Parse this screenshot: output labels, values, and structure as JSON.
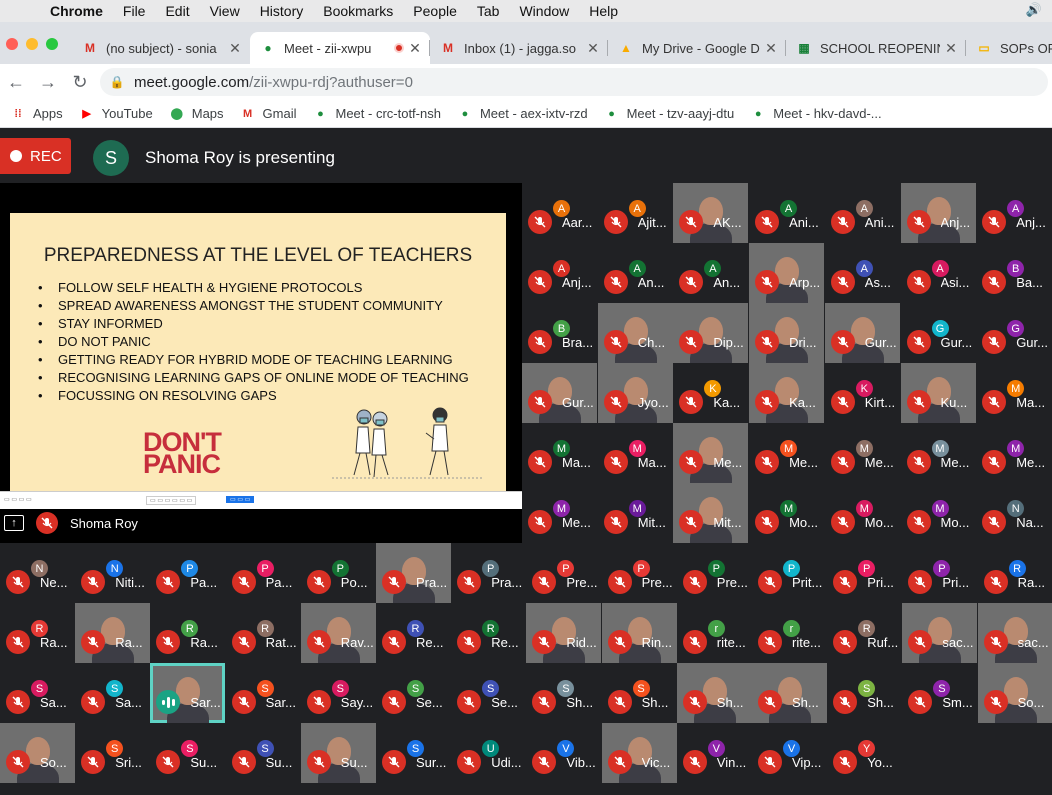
{
  "menubar": {
    "app": "Chrome",
    "items": [
      "File",
      "Edit",
      "View",
      "History",
      "Bookmarks",
      "People",
      "Tab",
      "Window",
      "Help"
    ]
  },
  "tabs": [
    {
      "title": "(no subject) - sonia",
      "icon": "gmail-icon",
      "color": "#d93025"
    },
    {
      "title": "Meet - zii-xwpu",
      "icon": "meet-icon",
      "color": "#1e8e3e",
      "active": true
    },
    {
      "title": "Inbox (1) - jagga.so",
      "icon": "gmail-icon",
      "color": "#d93025"
    },
    {
      "title": "My Drive - Google D",
      "icon": "drive-icon",
      "color": "#f9ab00"
    },
    {
      "title": "SCHOOL REOPENIN",
      "icon": "sheets-icon",
      "color": "#188038"
    },
    {
      "title": "SOPs OF",
      "icon": "slides-icon",
      "color": "#f4b400"
    }
  ],
  "url": {
    "host": "meet.google.com",
    "path": "/zii-xwpu-rdj?authuser=0"
  },
  "bookmarks": [
    {
      "label": "Apps",
      "icon": "apps-grid-icon"
    },
    {
      "label": "YouTube",
      "icon": "youtube-icon"
    },
    {
      "label": "Maps",
      "icon": "maps-icon"
    },
    {
      "label": "Gmail",
      "icon": "gmail-icon"
    },
    {
      "label": "Meet - crc-totf-nsh",
      "icon": "meet-icon"
    },
    {
      "label": "Meet - aex-ixtv-rzd",
      "icon": "meet-icon"
    },
    {
      "label": "Meet - tzv-aayj-dtu",
      "icon": "meet-icon"
    },
    {
      "label": "Meet - hkv-davd-...",
      "icon": "meet-icon"
    }
  ],
  "meet": {
    "rec_label": "REC",
    "presenter_initial": "S",
    "presenting_text": "Shoma Roy is presenting",
    "stage_name": "Shoma Roy"
  },
  "slide": {
    "title": "PREPAREDNESS AT THE LEVEL OF TEACHERS",
    "bullets": [
      "FOLLOW SELF HEALTH & HYGIENE PROTOCOLS",
      "SPREAD AWARENESS AMONGST THE STUDENT COMMUNITY",
      "STAY INFORMED",
      "DO NOT PANIC",
      "GETTING READY FOR HYBRID MODE OF TEACHING LEARNING",
      "RECOGNISING LEARNING GAPS OF ONLINE MODE OF TEACHING",
      "FOCUSSING ON RESOLVING GAPS"
    ],
    "tagline1": "DON'T",
    "tagline2": "PANIC"
  },
  "participants": [
    {
      "name": "Aar...",
      "initial": "A",
      "color": "#e8710a"
    },
    {
      "name": "Ajit...",
      "initial": "A",
      "color": "#e8710a"
    },
    {
      "name": "AK...",
      "video": true
    },
    {
      "name": "Ani...",
      "initial": "A",
      "color": "#137333"
    },
    {
      "name": "Ani...",
      "initial": "A",
      "color": "#8d6e63"
    },
    {
      "name": "Anj...",
      "video": true
    },
    {
      "name": "Anj...",
      "initial": "A",
      "color": "#8e24aa"
    },
    {
      "name": "Anj...",
      "initial": "A",
      "color": "#d93025"
    },
    {
      "name": "An...",
      "initial": "A",
      "color": "#137333"
    },
    {
      "name": "An...",
      "initial": "A",
      "color": "#137333"
    },
    {
      "name": "Arp...",
      "video": true
    },
    {
      "name": "As...",
      "initial": "A",
      "color": "#3f51b5"
    },
    {
      "name": "Asi...",
      "initial": "A",
      "color": "#d81b60"
    },
    {
      "name": "Ba...",
      "initial": "B",
      "color": "#8e24aa"
    },
    {
      "name": "Bra...",
      "initial": "B",
      "color": "#43a047"
    },
    {
      "name": "Ch...",
      "video": true
    },
    {
      "name": "Dip...",
      "video": true
    },
    {
      "name": "Dri...",
      "video": true
    },
    {
      "name": "Gur...",
      "video": true
    },
    {
      "name": "Gur...",
      "initial": "G",
      "color": "#12b5cb"
    },
    {
      "name": "Gur...",
      "initial": "G",
      "color": "#8e24aa"
    },
    {
      "name": "Gur...",
      "video": true
    },
    {
      "name": "Jyo...",
      "video": true
    },
    {
      "name": "Ka...",
      "initial": "K",
      "color": "#f29900"
    },
    {
      "name": "Ka...",
      "video": true
    },
    {
      "name": "Kirt...",
      "initial": "K",
      "color": "#d81b60"
    },
    {
      "name": "Ku...",
      "video": true
    },
    {
      "name": "Ma...",
      "initial": "M",
      "color": "#f57c00"
    },
    {
      "name": "Ma...",
      "initial": "M",
      "color": "#137333"
    },
    {
      "name": "Ma...",
      "initial": "M",
      "color": "#e91e63"
    },
    {
      "name": "Me...",
      "video": true
    },
    {
      "name": "Me...",
      "initial": "M",
      "color": "#f4511e"
    },
    {
      "name": "Me...",
      "initial": "M",
      "color": "#8d6e63"
    },
    {
      "name": "Me...",
      "initial": "M",
      "color": "#78909c"
    },
    {
      "name": "Me...",
      "initial": "M",
      "color": "#8e24aa"
    },
    {
      "name": "Me...",
      "initial": "M",
      "color": "#8e24aa"
    },
    {
      "name": "Mit...",
      "initial": "M",
      "color": "#6a1b9a"
    },
    {
      "name": "Mit...",
      "video": true
    },
    {
      "name": "Mo...",
      "initial": "M",
      "color": "#137333"
    },
    {
      "name": "Mo...",
      "initial": "M",
      "color": "#d81b60"
    },
    {
      "name": "Mo...",
      "initial": "M",
      "color": "#8e24aa"
    },
    {
      "name": "Na...",
      "initial": "N",
      "color": "#546e7a"
    },
    {
      "name": "Ne...",
      "initial": "N",
      "color": "#8d6e63"
    },
    {
      "name": "Niti...",
      "initial": "N",
      "color": "#1a73e8"
    },
    {
      "name": "Pa...",
      "initial": "P",
      "color": "#1e88e5"
    },
    {
      "name": "Pa...",
      "initial": "P",
      "color": "#e91e63"
    },
    {
      "name": "Po...",
      "initial": "P",
      "color": "#137333"
    },
    {
      "name": "Pra...",
      "video": true
    },
    {
      "name": "Pra...",
      "initial": "P",
      "color": "#546e7a"
    },
    {
      "name": "Pre...",
      "initial": "P",
      "color": "#e53935"
    },
    {
      "name": "Pre...",
      "initial": "P",
      "color": "#e53935"
    },
    {
      "name": "Pre...",
      "initial": "P",
      "color": "#137333"
    },
    {
      "name": "Prit...",
      "initial": "P",
      "color": "#12b5cb"
    },
    {
      "name": "Pri...",
      "initial": "P",
      "color": "#e91e63"
    },
    {
      "name": "Pri...",
      "initial": "P",
      "color": "#8e24aa"
    },
    {
      "name": "Ra...",
      "initial": "R",
      "color": "#1a73e8"
    },
    {
      "name": "Ra...",
      "initial": "R",
      "color": "#e53935"
    },
    {
      "name": "Ra...",
      "video": true
    },
    {
      "name": "Ra...",
      "initial": "R",
      "color": "#43a047"
    },
    {
      "name": "Rat...",
      "initial": "R",
      "color": "#8d6e63"
    },
    {
      "name": "Rav...",
      "video": true
    },
    {
      "name": "Re...",
      "initial": "R",
      "color": "#3f51b5"
    },
    {
      "name": "Re...",
      "initial": "R",
      "color": "#137333"
    },
    {
      "name": "Rid...",
      "video": true
    },
    {
      "name": "Rin...",
      "video": true
    },
    {
      "name": "rite...",
      "initial": "r",
      "color": "#43a047"
    },
    {
      "name": "rite...",
      "initial": "r",
      "color": "#43a047"
    },
    {
      "name": "Ruf...",
      "initial": "R",
      "color": "#8d6e63"
    },
    {
      "name": "sac...",
      "video": true
    },
    {
      "name": "sac...",
      "video": true
    },
    {
      "name": "Sa...",
      "initial": "S",
      "color": "#d81b60"
    },
    {
      "name": "Sa...",
      "initial": "S",
      "color": "#12b5cb"
    },
    {
      "name": "Sar...",
      "video": true,
      "speaking": true
    },
    {
      "name": "Sar...",
      "initial": "S",
      "color": "#f4511e"
    },
    {
      "name": "Say...",
      "initial": "S",
      "color": "#d81b60"
    },
    {
      "name": "Se...",
      "initial": "S",
      "color": "#43a047"
    },
    {
      "name": "Se...",
      "initial": "S",
      "color": "#3f51b5"
    },
    {
      "name": "Sh...",
      "initial": "S",
      "color": "#78909c"
    },
    {
      "name": "Sh...",
      "initial": "S",
      "color": "#f4511e"
    },
    {
      "name": "Sh...",
      "video": true
    },
    {
      "name": "Sh...",
      "video": true
    },
    {
      "name": "Sh...",
      "initial": "S",
      "color": "#7cb342"
    },
    {
      "name": "Sm...",
      "initial": "S",
      "color": "#8e24aa"
    },
    {
      "name": "So...",
      "video": true
    },
    {
      "name": "So...",
      "video": true
    },
    {
      "name": "Sri...",
      "initial": "S",
      "color": "#f4511e"
    },
    {
      "name": "Su...",
      "initial": "S",
      "color": "#e91e63"
    },
    {
      "name": "Su...",
      "initial": "S",
      "color": "#3f51b5"
    },
    {
      "name": "Su...",
      "video": true
    },
    {
      "name": "Sur...",
      "initial": "S",
      "color": "#1a73e8"
    },
    {
      "name": "Udi...",
      "initial": "U",
      "color": "#00897b"
    },
    {
      "name": "Vib...",
      "initial": "V",
      "color": "#1a73e8"
    },
    {
      "name": "Vic...",
      "video": true
    },
    {
      "name": "Vin...",
      "initial": "V",
      "color": "#8e24aa"
    },
    {
      "name": "Vip...",
      "initial": "V",
      "color": "#1a73e8"
    },
    {
      "name": "Yo...",
      "initial": "Y",
      "color": "#e53935"
    }
  ]
}
